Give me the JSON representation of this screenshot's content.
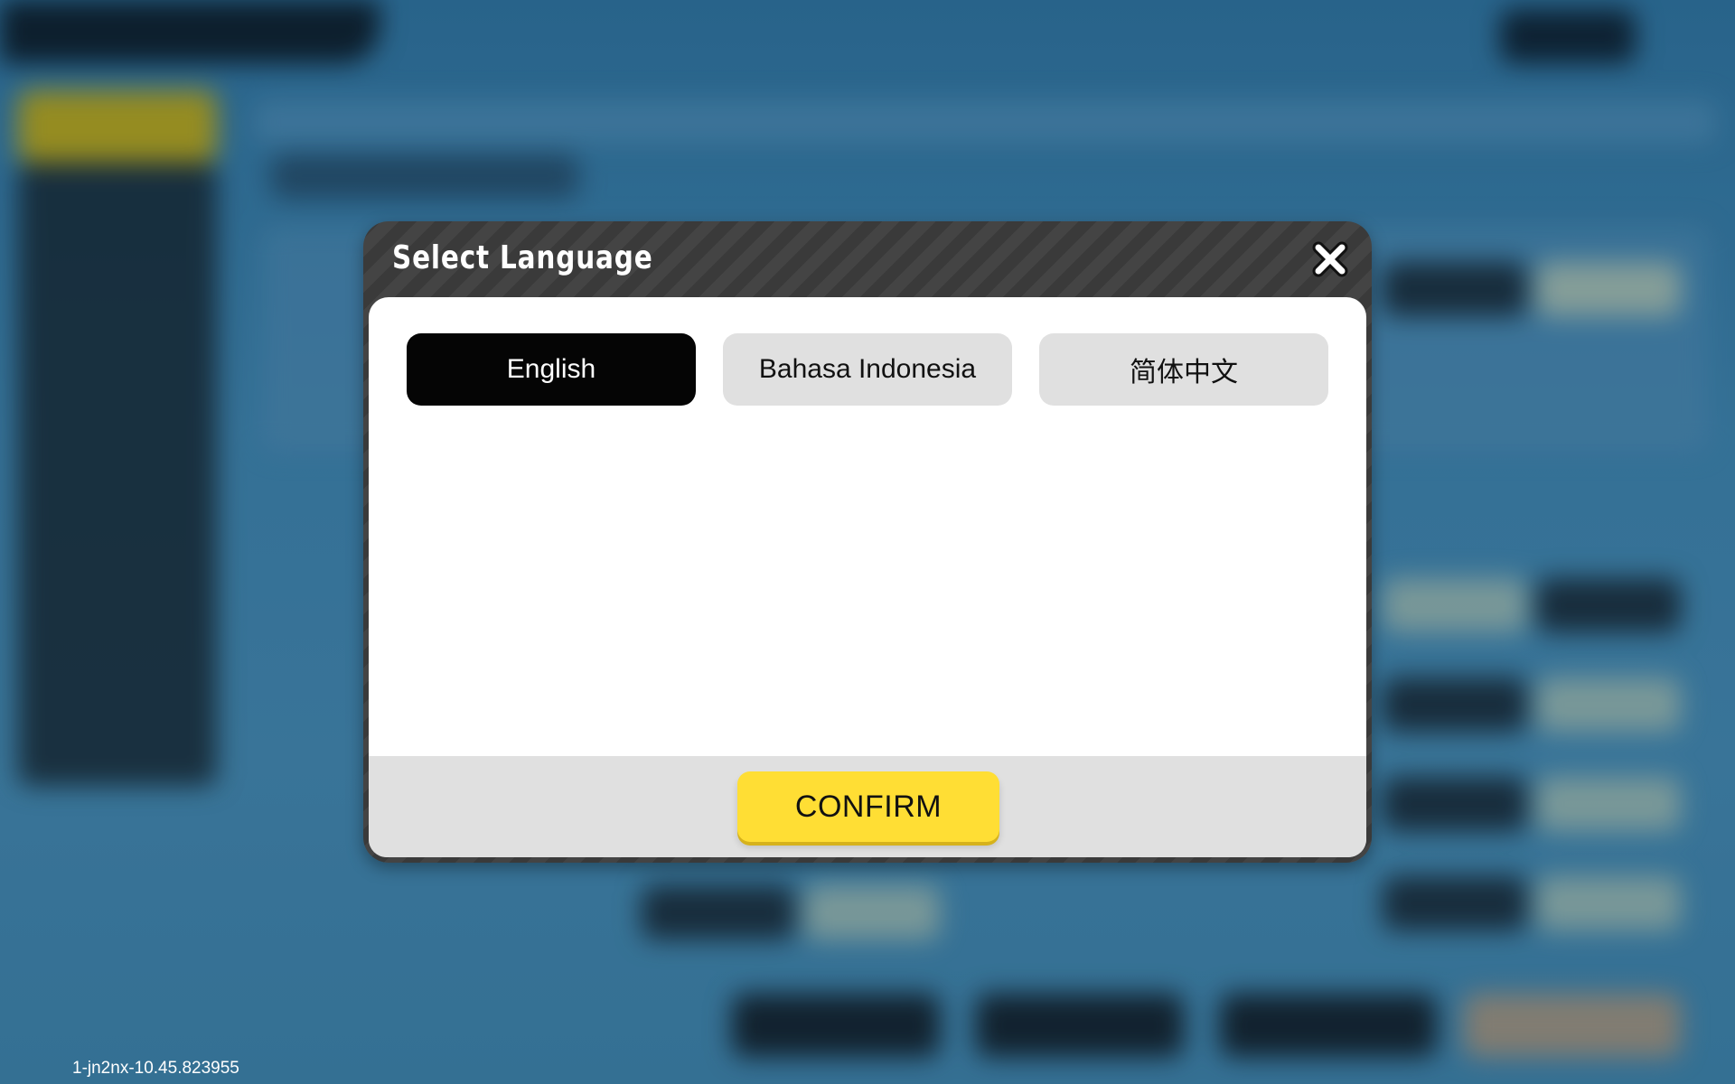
{
  "dialog": {
    "title": "Select Language",
    "languages": [
      {
        "label": "English",
        "selected": true
      },
      {
        "label": "Bahasa Indonesia",
        "selected": false
      },
      {
        "label": "简体中文",
        "selected": false
      }
    ],
    "confirm_label": "CONFIRM"
  },
  "build_id": "1-jn2nx-10.45.823955",
  "colors": {
    "selected_bg": "#050505",
    "unselected_bg": "#e0e0e0",
    "confirm_bg": "#ffde34",
    "header_bg": "#3a3a3a"
  },
  "icons": {
    "close": "close-icon"
  }
}
